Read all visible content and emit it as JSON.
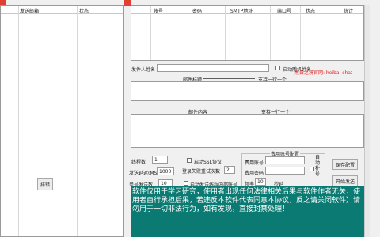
{
  "left_table": {
    "col_sender": "发送邮箱",
    "col_status": "状态"
  },
  "left_button_label": "排错",
  "account_table": {
    "columns": [
      "",
      "帐号",
      "密码",
      "SMTP地址",
      "端口号",
      "状态",
      "统计"
    ]
  },
  "sender_name_label": "发件人姓名",
  "random_name_label": "启动随机姓名",
  "hint_text": "黑白之境官网: heibai chat",
  "mail_title_label": "邮件标题",
  "mail_title_sep": "支持一行一个",
  "mail_content_label": "邮件内容",
  "mail_content_sep": "支持一行一个",
  "settings": {
    "threads_label": "线程数",
    "threads_value": "1",
    "ssl_label": "启动SSL协议",
    "send_delay_label": "发送延迟(MS)",
    "send_delay_value": "1000",
    "login_fail_label": "登录失败重试次数",
    "login_fail_value": "2",
    "per_count_label": "单号发送数",
    "per_count_value": "10",
    "switch_label": "启动发送线程内部账号"
  },
  "account_config": {
    "title": "费用账号配置",
    "fee_account_label": "费用账号",
    "fee_password_label": "费用密码",
    "freq_label": "频率",
    "freq_value": "10",
    "freq_unit": "秒延",
    "side_label": "自动补号",
    "save_button": "保存配置",
    "start_button": "开始发送"
  },
  "notice": "软件仅用于学习研究，使用者出现任何法律相关后果与软件作者无关，使用者自行承担后果，若违反本软件代表同意本协议，反之请关闭软件）请勿用于一切非法行为，如有发现，直接封禁处理！"
}
